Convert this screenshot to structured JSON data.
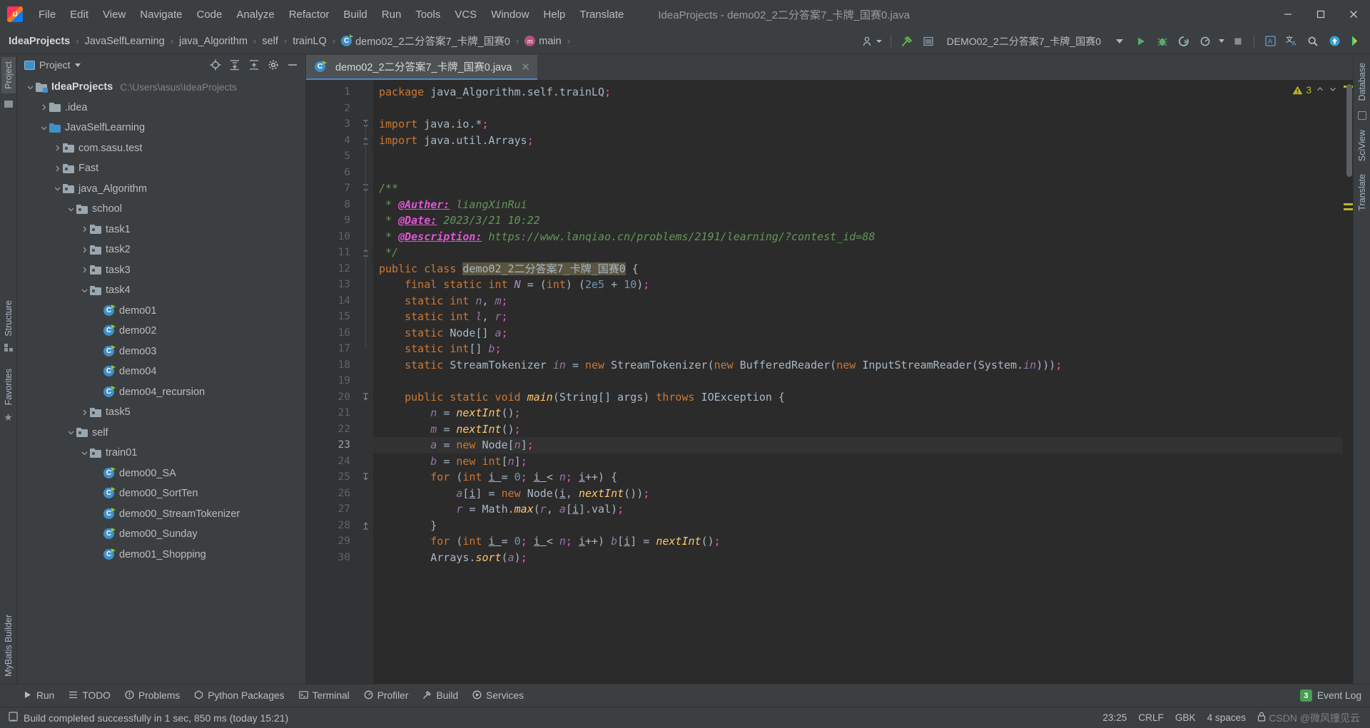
{
  "window": {
    "title": "IdeaProjects - demo02_2二分答案7_卡牌_国赛0.java",
    "minimize": "—",
    "maximize": "▢",
    "close": "✕"
  },
  "menubar": {
    "items": [
      {
        "label": "File"
      },
      {
        "label": "Edit"
      },
      {
        "label": "View"
      },
      {
        "label": "Navigate"
      },
      {
        "label": "Code"
      },
      {
        "label": "Analyze"
      },
      {
        "label": "Refactor"
      },
      {
        "label": "Build"
      },
      {
        "label": "Run"
      },
      {
        "label": "Tools"
      },
      {
        "label": "VCS"
      },
      {
        "label": "Window"
      },
      {
        "label": "Help"
      },
      {
        "label": "Translate"
      }
    ]
  },
  "navbar": {
    "breadcrumbs": [
      {
        "label": "IdeaProjects",
        "icon": "none",
        "bold": true
      },
      {
        "label": "JavaSelfLearning",
        "icon": "none",
        "bold": false
      },
      {
        "label": "java_Algorithm",
        "icon": "none",
        "bold": false
      },
      {
        "label": "self",
        "icon": "none",
        "bold": false
      },
      {
        "label": "trainLQ",
        "icon": "none",
        "bold": false
      },
      {
        "label": "demo02_2二分答案7_卡牌_国赛0",
        "icon": "class",
        "bold": false
      },
      {
        "label": "main",
        "icon": "method",
        "bold": false
      }
    ],
    "separator": "›",
    "run_config": "DEMO02_2二分答案7_卡牌_国赛0",
    "icons": {
      "user": "account-icon",
      "build_hammer": "build-hammer-icon",
      "open_ide": "open-preview-icon",
      "dropdown": "chevron-down-icon",
      "run": "run-icon",
      "debug": "debug-icon",
      "run_coverage": "run-coverage-icon",
      "profile": "profile-icon",
      "stop": "stop-icon",
      "translate_panel": "translate-panel-icon",
      "translate": "translate-icon",
      "search": "search-icon",
      "update": "update-icon",
      "ai": "ai-icon"
    }
  },
  "left_stripe": {
    "top": [
      "Project"
    ],
    "middle": [
      "Structure",
      "Favorites"
    ],
    "bottom": [
      "MyBatis Builder"
    ]
  },
  "right_stripe": {
    "items": [
      "Database",
      "SciView",
      "Translate"
    ]
  },
  "project_panel": {
    "title": "Project",
    "actions": [
      "locate-icon",
      "expand-all-icon",
      "collapse-all-icon",
      "settings-gear-icon",
      "hide-icon"
    ],
    "tree": [
      {
        "label": "IdeaProjects",
        "path": "C:\\Users\\asus\\IdeaProjects",
        "indent": 0,
        "twisty": "open",
        "icon": "folder-root",
        "bold": true
      },
      {
        "label": ".idea",
        "path": "",
        "indent": 1,
        "twisty": "closed",
        "icon": "folder",
        "bold": false
      },
      {
        "label": "JavaSelfLearning",
        "path": "",
        "indent": 1,
        "twisty": "open",
        "icon": "folder-blue",
        "bold": false
      },
      {
        "label": "com.sasu.test",
        "path": "",
        "indent": 2,
        "twisty": "closed",
        "icon": "folder-pkg",
        "bold": false
      },
      {
        "label": "Fast",
        "path": "",
        "indent": 2,
        "twisty": "closed",
        "icon": "folder-pkg",
        "bold": false
      },
      {
        "label": "java_Algorithm",
        "path": "",
        "indent": 2,
        "twisty": "open",
        "icon": "folder-pkg",
        "bold": false
      },
      {
        "label": "school",
        "path": "",
        "indent": 3,
        "twisty": "open",
        "icon": "folder-pkg",
        "bold": false
      },
      {
        "label": "task1",
        "path": "",
        "indent": 4,
        "twisty": "closed",
        "icon": "folder-pkg",
        "bold": false
      },
      {
        "label": "task2",
        "path": "",
        "indent": 4,
        "twisty": "closed",
        "icon": "folder-pkg",
        "bold": false
      },
      {
        "label": "task3",
        "path": "",
        "indent": 4,
        "twisty": "closed",
        "icon": "folder-pkg",
        "bold": false
      },
      {
        "label": "task4",
        "path": "",
        "indent": 4,
        "twisty": "open",
        "icon": "folder-pkg",
        "bold": false
      },
      {
        "label": "demo01",
        "path": "",
        "indent": 5,
        "twisty": "none",
        "icon": "class",
        "bold": false
      },
      {
        "label": "demo02",
        "path": "",
        "indent": 5,
        "twisty": "none",
        "icon": "class",
        "bold": false
      },
      {
        "label": "demo03",
        "path": "",
        "indent": 5,
        "twisty": "none",
        "icon": "class",
        "bold": false
      },
      {
        "label": "demo04",
        "path": "",
        "indent": 5,
        "twisty": "none",
        "icon": "class",
        "bold": false
      },
      {
        "label": "demo04_recursion",
        "path": "",
        "indent": 5,
        "twisty": "none",
        "icon": "class",
        "bold": false
      },
      {
        "label": "task5",
        "path": "",
        "indent": 4,
        "twisty": "closed",
        "icon": "folder-pkg",
        "bold": false
      },
      {
        "label": "self",
        "path": "",
        "indent": 3,
        "twisty": "open",
        "icon": "folder-pkg",
        "bold": false
      },
      {
        "label": "train01",
        "path": "",
        "indent": 4,
        "twisty": "open",
        "icon": "folder-pkg",
        "bold": false
      },
      {
        "label": "demo00_SA",
        "path": "",
        "indent": 5,
        "twisty": "none",
        "icon": "class",
        "bold": false
      },
      {
        "label": "demo00_SortTen",
        "path": "",
        "indent": 5,
        "twisty": "none",
        "icon": "class",
        "bold": false
      },
      {
        "label": "demo00_StreamTokenizer",
        "path": "",
        "indent": 5,
        "twisty": "none",
        "icon": "class",
        "bold": false
      },
      {
        "label": "demo00_Sunday",
        "path": "",
        "indent": 5,
        "twisty": "none",
        "icon": "class",
        "bold": false
      },
      {
        "label": "demo01_Shopping",
        "path": "",
        "indent": 5,
        "twisty": "none",
        "icon": "class",
        "bold": false
      }
    ]
  },
  "editor": {
    "tab": {
      "label": "demo02_2二分答案7_卡牌_国赛0.java",
      "close": "✕",
      "icon": "class"
    },
    "inspection": {
      "warning_count": "3",
      "chevron_up": "⌃",
      "chevron_down": "⌄"
    },
    "first_line": 1,
    "current_line": 23,
    "lines": [
      {
        "n": 1,
        "fold": "",
        "run": false,
        "html": "<span class=\"kw\">package</span> java_Algorithm.self.trainLQ<span class=\"pk\">;</span>"
      },
      {
        "n": 2,
        "fold": "",
        "run": false,
        "html": ""
      },
      {
        "n": 3,
        "fold": "open",
        "run": false,
        "html": "<span class=\"kw\">import</span> java.io.*<span class=\"pk\">;</span>"
      },
      {
        "n": 4,
        "fold": "end",
        "run": false,
        "html": "<span class=\"kw\">import</span> java.util.Arrays<span class=\"pk\">;</span>"
      },
      {
        "n": 5,
        "fold": "",
        "run": false,
        "html": ""
      },
      {
        "n": 6,
        "fold": "",
        "run": false,
        "html": ""
      },
      {
        "n": 7,
        "fold": "open",
        "run": false,
        "html": "<span class=\"cmt\">/**</span>"
      },
      {
        "n": 8,
        "fold": "",
        "run": false,
        "html": "<span class=\"cmt\"> * </span><span class=\"tag\">@Auther:</span><span class=\"cmt\"> liangXinRui</span>"
      },
      {
        "n": 9,
        "fold": "",
        "run": false,
        "html": "<span class=\"cmt\"> * </span><span class=\"tag\">@Date:</span><span class=\"cmt\"> 2023/3/21 10:22</span>"
      },
      {
        "n": 10,
        "fold": "",
        "run": false,
        "html": "<span class=\"cmt\"> * </span><span class=\"tag\">@Description:</span><span class=\"cmt\"> https://www.lanqiao.cn/problems/2191/learning/?contest_id=88</span>"
      },
      {
        "n": 11,
        "fold": "end",
        "run": false,
        "html": "<span class=\"cmt\"> */</span>"
      },
      {
        "n": 12,
        "fold": "",
        "run": true,
        "html": "<span class=\"kw\">public class </span><span class=\"cls-name-hl\">demo02_2二分答案7_卡牌_国赛0</span> {"
      },
      {
        "n": 13,
        "fold": "",
        "run": false,
        "html": "    <span class=\"kw\">final static int </span><span class=\"sfld\">N </span>= (<span class=\"kw\">int</span>) (<span class=\"num\">2e5 </span>+ <span class=\"num\">10</span>)<span class=\"pk\">;</span>"
      },
      {
        "n": 14,
        "fold": "",
        "run": false,
        "html": "    <span class=\"kw\">static int </span><span class=\"fld\">n</span>, <span class=\"fld\">m</span><span class=\"pk\">;</span>"
      },
      {
        "n": 15,
        "fold": "",
        "run": false,
        "html": "    <span class=\"kw\">static int </span><span class=\"fld\">l</span>, <span class=\"fld\">r</span><span class=\"pk\">;</span>"
      },
      {
        "n": 16,
        "fold": "",
        "run": false,
        "html": "    <span class=\"kw\">static </span>Node[] <span class=\"fld\">a</span><span class=\"pk\">;</span>"
      },
      {
        "n": 17,
        "fold": "",
        "run": false,
        "html": "    <span class=\"kw\">static int</span>[] <span class=\"fld\">b</span><span class=\"pk\">;</span>"
      },
      {
        "n": 18,
        "fold": "",
        "run": false,
        "html": "    <span class=\"kw\">static </span>StreamTokenizer <span class=\"fld\">in </span>= <span class=\"kw\">new </span>StreamTokenizer(<span class=\"kw\">new </span>BufferedReader(<span class=\"kw\">new </span>InputStreamReader(System.<span class=\"fld\">in</span>)))<span class=\"pk\">;</span>"
      },
      {
        "n": 19,
        "fold": "",
        "run": false,
        "html": ""
      },
      {
        "n": 20,
        "fold": "open",
        "run": true,
        "html": "    <span class=\"kw\">public static void </span><span class=\"mth\">main</span>(String[] <span class=\"prm\">args</span>) <span class=\"kw\">throws </span>IOException {"
      },
      {
        "n": 21,
        "fold": "",
        "run": false,
        "html": "        <span class=\"fld\">n </span>= <span class=\"mth\">nextInt</span>()<span class=\"pk\">;</span>"
      },
      {
        "n": 22,
        "fold": "",
        "run": false,
        "html": "        <span class=\"fld\">m </span>= <span class=\"mth\">nextInt</span>()<span class=\"pk\">;</span>"
      },
      {
        "n": 23,
        "fold": "",
        "run": false,
        "html": "        <span class=\"fld\">a </span>= <span class=\"kw\">new </span>Node[<span class=\"fld\">n</span>]<span class=\"pk\">;</span>"
      },
      {
        "n": 24,
        "fold": "",
        "run": false,
        "html": "        <span class=\"fld\">b </span>= <span class=\"kw\">new int</span>[<span class=\"fld\">n</span>]<span class=\"pk\">;</span>"
      },
      {
        "n": 25,
        "fold": "open",
        "run": false,
        "html": "        <span class=\"kw\">for </span>(<span class=\"kw\">int </span><span class=\"und\">i </span>= <span class=\"num\">0</span><span class=\"pk\">; </span><span class=\"und\">i </span>&lt; <span class=\"fld\">n</span><span class=\"pk\">; </span><span class=\"und\">i</span>++) {"
      },
      {
        "n": 26,
        "fold": "",
        "run": false,
        "html": "            <span class=\"fld\">a</span>[<span class=\"und\">i</span>] = <span class=\"kw\">new </span>Node(<span class=\"und\">i</span>, <span class=\"mth\">nextInt</span>())<span class=\"pk\">;</span>"
      },
      {
        "n": 27,
        "fold": "",
        "run": false,
        "html": "            <span class=\"fld\">r </span>= Math.<span class=\"mth\">max</span>(<span class=\"fld\">r</span>, <span class=\"fld\">a</span>[<span class=\"und\">i</span>].val)<span class=\"pk\">;</span>"
      },
      {
        "n": 28,
        "fold": "end",
        "run": false,
        "html": "        }"
      },
      {
        "n": 29,
        "fold": "",
        "run": false,
        "html": "        <span class=\"kw\">for </span>(<span class=\"kw\">int </span><span class=\"und\">i </span>= <span class=\"num\">0</span><span class=\"pk\">; </span><span class=\"und\">i </span>&lt; <span class=\"fld\">n</span><span class=\"pk\">; </span><span class=\"und\">i</span>++) <span class=\"fld\">b</span>[<span class=\"und\">i</span>] = <span class=\"mth\">nextInt</span>()<span class=\"pk\">;</span>"
      },
      {
        "n": 30,
        "fold": "",
        "run": false,
        "html": "        Arrays.<span class=\"mth\">sort</span>(<span class=\"fld\">a</span>)<span class=\"pk\">;</span>"
      }
    ]
  },
  "bottom_bar": {
    "tools": [
      {
        "label": "Run",
        "icon": "run-icon"
      },
      {
        "label": "TODO",
        "icon": "todo-icon"
      },
      {
        "label": "Problems",
        "icon": "problems-icon"
      },
      {
        "label": "Python Packages",
        "icon": "python-packages-icon"
      },
      {
        "label": "Terminal",
        "icon": "terminal-icon"
      },
      {
        "label": "Profiler",
        "icon": "profiler-icon"
      },
      {
        "label": "Build",
        "icon": "build-hammer-icon"
      },
      {
        "label": "Services",
        "icon": "services-icon"
      }
    ],
    "event_log": {
      "label": "Event Log",
      "count": "3"
    }
  },
  "statusbar": {
    "message": "Build completed successfully in 1 sec, 850 ms (today 15:21)",
    "caret": "23:25",
    "line_sep": "CRLF",
    "encoding": "GBK",
    "indent": "4 spaces",
    "lock_icon": "lock-icon",
    "watermark": "CSDN @微风撞见云"
  }
}
